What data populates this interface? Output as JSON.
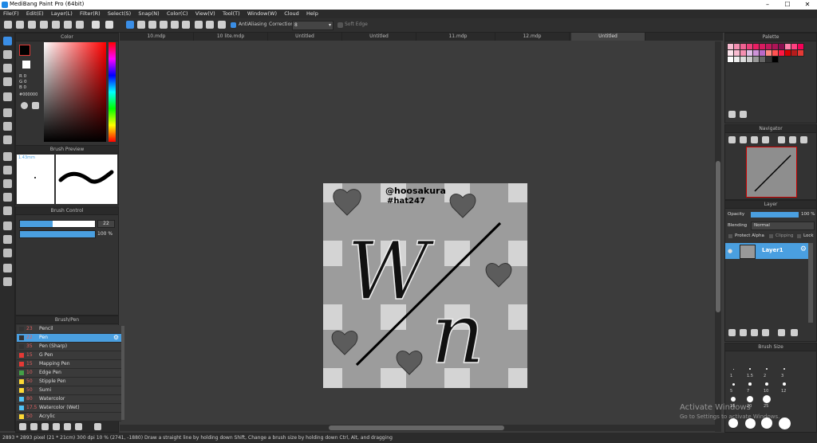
{
  "window": {
    "title": "MediBang Paint Pro (64bit)",
    "controls": [
      "–",
      "☐",
      "✕"
    ]
  },
  "menu": [
    "File(F)",
    "Edit(E)",
    "Layer(L)",
    "Filter(R)",
    "Select(S)",
    "Snap(N)",
    "Color(C)",
    "View(V)",
    "Tool(T)",
    "Window(W)",
    "Cloud",
    "Help"
  ],
  "toolbar": {
    "antialiasing": "AntiAliasing",
    "correction_label": "Correction",
    "correction_value": "8",
    "soft_edge": "Soft Edge"
  },
  "tabs": [
    "10.mdp",
    "10 lite.mdp",
    "Untitled",
    "Untitled",
    "11.mdp",
    "12.mdp",
    "Untitled"
  ],
  "color_panel": {
    "title": "Color",
    "r": "R 0",
    "g": "G 0",
    "b": "B 0",
    "hex": "#000000"
  },
  "brush_preview": {
    "title": "Brush Preview",
    "size": "1.43mm"
  },
  "brush_control": {
    "title": "Brush Control",
    "size": "22",
    "opacity": "100 %",
    "size_fill": 0.44,
    "opacity_fill": 1.0
  },
  "brush_list": {
    "title": "Brush/Pen",
    "items": [
      {
        "size": "23",
        "name": "Pencil",
        "color": "#333333"
      },
      {
        "size": "22",
        "name": "Pen",
        "color": "#333333",
        "selected": true
      },
      {
        "size": "35",
        "name": "Pen (Sharp)",
        "color": "#333333"
      },
      {
        "size": "15",
        "name": "G Pen",
        "color": "#e53935"
      },
      {
        "size": "15",
        "name": "Mapping Pen",
        "color": "#e53935"
      },
      {
        "size": "10",
        "name": "Edge Pen",
        "color": "#43a047"
      },
      {
        "size": "50",
        "name": "Stipple Pen",
        "color": "#fdd835"
      },
      {
        "size": "50",
        "name": "Sumi",
        "color": "#fdd835"
      },
      {
        "size": "80",
        "name": "Watercolor",
        "color": "#4fc3f7"
      },
      {
        "size": "17.5",
        "name": "Watercolor (Wet)",
        "color": "#4fc3f7"
      },
      {
        "size": "50",
        "name": "Acrylic",
        "color": "#fdd835"
      }
    ]
  },
  "artwork": {
    "handle": "@hoosakura",
    "tag": "#hat247",
    "letters": [
      "W",
      "n"
    ]
  },
  "palette": {
    "title": "Palette"
  },
  "navigator": {
    "title": "Navigator"
  },
  "layer_panel": {
    "title": "Layer",
    "opacity_label": "Opacity",
    "opacity_value": "100 %",
    "blending_label": "Blending",
    "blending_value": "Normal",
    "protect_alpha": "Protect Alpha",
    "clipping": "Clipping",
    "lock": "Lock",
    "layer_name": "Layer1"
  },
  "brush_size_panel": {
    "title": "Brush Size",
    "sizes": [
      "1",
      "1.5",
      "2",
      "3",
      "5",
      "7",
      "10",
      "12",
      "15",
      "20",
      "25"
    ]
  },
  "watermark": {
    "line1": "Activate Windows",
    "line2": "Go to Settings to activate Windows."
  },
  "status": "2893 * 2893 pixel (21 * 21cm) 300 dpi 10 % (2741, -1880) Draw a straight line by holding down Shift, Change a brush size by holding down Ctrl, Alt, and dragging",
  "colors": {
    "accent": "#4a9fe0",
    "panel": "#333333",
    "bg": "#3c3c3c"
  }
}
